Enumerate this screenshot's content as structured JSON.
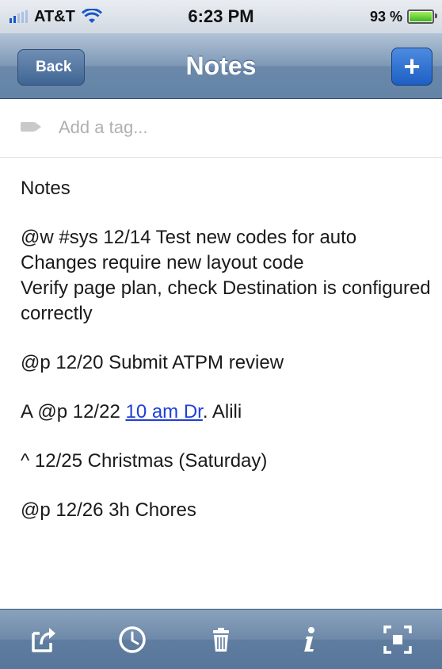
{
  "status_bar": {
    "carrier": "AT&T",
    "time": "6:23 PM",
    "battery": "93 %",
    "battery_level": 0.93
  },
  "nav": {
    "back_label": "Back",
    "title": "Notes",
    "add_label": "+"
  },
  "tag": {
    "placeholder": "Add a tag..."
  },
  "note": {
    "title": "Notes",
    "entry1_lines": [
      "@w #sys 12/14 Test new codes for auto",
      "Changes require new layout code",
      "Verify page plan, check Destination is configured correctly"
    ],
    "entry2": "@p 12/20 Submit ATPM review",
    "entry3": {
      "prefix": "A @p 12/22 ",
      "link": "10 am Dr",
      "suffix": ". Alili"
    },
    "entry4": "^ 12/25 Christmas (Saturday)",
    "entry5": "@p 12/26 3h Chores"
  },
  "toolbar": {
    "icons": [
      "share-icon",
      "clock-icon",
      "trash-icon",
      "info-icon",
      "fullscreen-icon"
    ]
  },
  "colors": {
    "nav_accent": "#6383a6",
    "add_button": "#1d5fc4",
    "link": "#1f3fd8"
  }
}
